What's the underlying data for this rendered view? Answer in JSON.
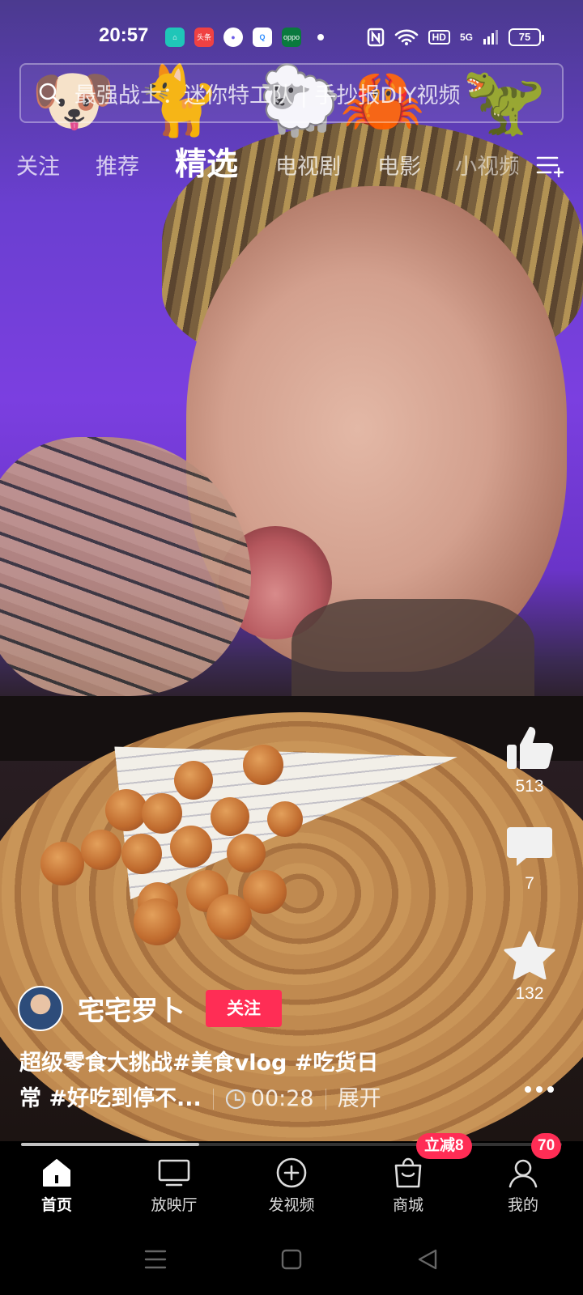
{
  "status_bar": {
    "time": "20:57",
    "notification_apps": [
      {
        "icon": "home-app-icon",
        "label": "",
        "color": "#1fc6b8"
      },
      {
        "icon": "toutiao-app-icon",
        "label": "头条",
        "color": "#f04142"
      },
      {
        "icon": "circle-app-icon",
        "label": "",
        "color": "#6c5ce7"
      },
      {
        "icon": "q-app-icon",
        "label": "",
        "color": "#2b8cff"
      },
      {
        "icon": "oppo-app-icon",
        "label": "oppo",
        "color": "#0a7a3e"
      }
    ],
    "network_label": "HD",
    "signal_label": "5G",
    "battery": "75"
  },
  "search": {
    "placeholder": "最强战士：迷你特工队 | 手抄报DIY视频"
  },
  "emojis": [
    "🐶",
    "🐈",
    "🐑",
    "🦀",
    "🦖"
  ],
  "tabs": [
    {
      "label": "关注",
      "active": false
    },
    {
      "label": "推荐",
      "active": false
    },
    {
      "label": "精选",
      "active": true
    },
    {
      "label": "电视剧",
      "active": false
    },
    {
      "label": "电影",
      "active": false
    },
    {
      "label": "小视频",
      "active": false
    }
  ],
  "actions": {
    "like_count": "513",
    "comment_count": "7",
    "favorite_count": "132"
  },
  "author": {
    "name": "宅宅罗卜",
    "follow_label": "关注"
  },
  "caption": {
    "line1": "超级零食大挑战#美食vlog #吃货日",
    "line2": "常 #好吃到停不...",
    "duration": "00:28",
    "expand_label": "展开"
  },
  "playback_progress": 0.33,
  "bottom_nav": [
    {
      "label": "首页",
      "icon": "home-icon",
      "active": true
    },
    {
      "label": "放映厅",
      "icon": "tv-icon",
      "active": false
    },
    {
      "label": "发视频",
      "icon": "add-video-icon",
      "active": false
    },
    {
      "label": "商城",
      "icon": "shopping-bag-icon",
      "active": false,
      "badge": "立减8"
    },
    {
      "label": "我的",
      "icon": "profile-icon",
      "active": false,
      "badge": "70"
    }
  ],
  "colors": {
    "accent": "#ff2d55",
    "background_purple": "#7b3fe0"
  }
}
